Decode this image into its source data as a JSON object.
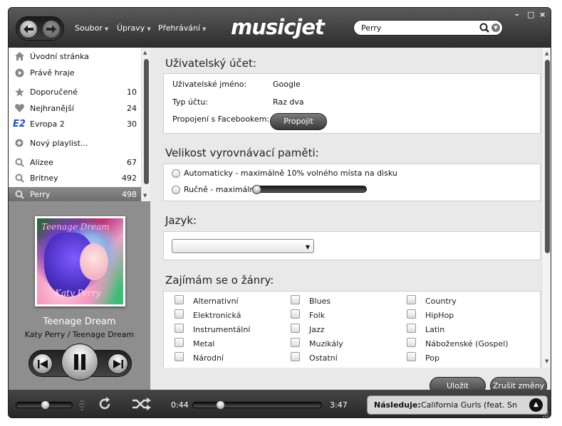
{
  "menu": [
    {
      "label": "Soubor"
    },
    {
      "label": "Úpravy"
    },
    {
      "label": "Přehrávání"
    }
  ],
  "logo": "musicjet",
  "search": {
    "value": "Perry"
  },
  "window_controls": {
    "minimize": "–",
    "maximize": "□",
    "close": "×"
  },
  "sidebar": {
    "items": [
      {
        "icon": "home-icon",
        "label": "Úvodní stránka",
        "count": ""
      },
      {
        "icon": "play-circle-icon",
        "label": "Právě hraje",
        "count": ""
      },
      {
        "icon": "star-icon",
        "label": "Doporučené",
        "count": "10"
      },
      {
        "icon": "heart-icon",
        "label": "Nejhranější",
        "count": "24"
      },
      {
        "icon": "evropa2-logo-icon",
        "label": "Evropa 2",
        "count": "30"
      },
      {
        "icon": "plus-circle-icon",
        "label": "Nový playlist...",
        "count": ""
      },
      {
        "icon": "search-icon",
        "label": "Alizee",
        "count": "67"
      },
      {
        "icon": "search-icon",
        "label": "Britney",
        "count": "492"
      },
      {
        "icon": "search-icon",
        "label": "Perry",
        "count": "498"
      }
    ],
    "evropa_logo_text": "E2"
  },
  "now_playing": {
    "album_text_top": "Teenage Dream",
    "album_text_bottom": "Katy Perry",
    "title": "Teenage Dream",
    "subtitle": "Katy Perry / Teenage Dream"
  },
  "settings": {
    "account": {
      "heading": "Uživatelský účet:",
      "username_label": "Uživatelské jméno:",
      "username_value": "Google",
      "type_label": "Typ účtu:",
      "type_value": "Raz dva",
      "facebook_label": "Propojení s Facebookem:",
      "facebook_button": "Propojit"
    },
    "cache": {
      "heading": "Velikost vyrovnávací paměti:",
      "auto_label": "Automaticky - maximálně 10% volného místa na disku",
      "manual_label": "Ručně - maximálně"
    },
    "language": {
      "heading": "Jazyk:",
      "selected": ""
    },
    "genres": {
      "heading": "Zajímám se o žánry:",
      "items": [
        "Alternativní",
        "Blues",
        "Country",
        "Elektronická",
        "Folk",
        "HipHop",
        "Instrumentální",
        "Jazz",
        "Latin",
        "Metal",
        "Muzikály",
        "Náboženské (Gospel)",
        "Národní",
        "Ostatní",
        "Pop"
      ]
    },
    "save_button": "Uložit",
    "cancel_button": "Zrušit změny"
  },
  "bottom": {
    "elapsed": "0:44",
    "total": "3:47",
    "next_label": "Následuje:",
    "next_track": "California Gurls (feat. Sno...",
    "volume_level": 0.5,
    "progress": 0.19
  },
  "colors": {
    "chrome_dark": "#2c2c2c",
    "selected_row": "#7a7a7a",
    "panel_bg": "#e9e9e9"
  }
}
